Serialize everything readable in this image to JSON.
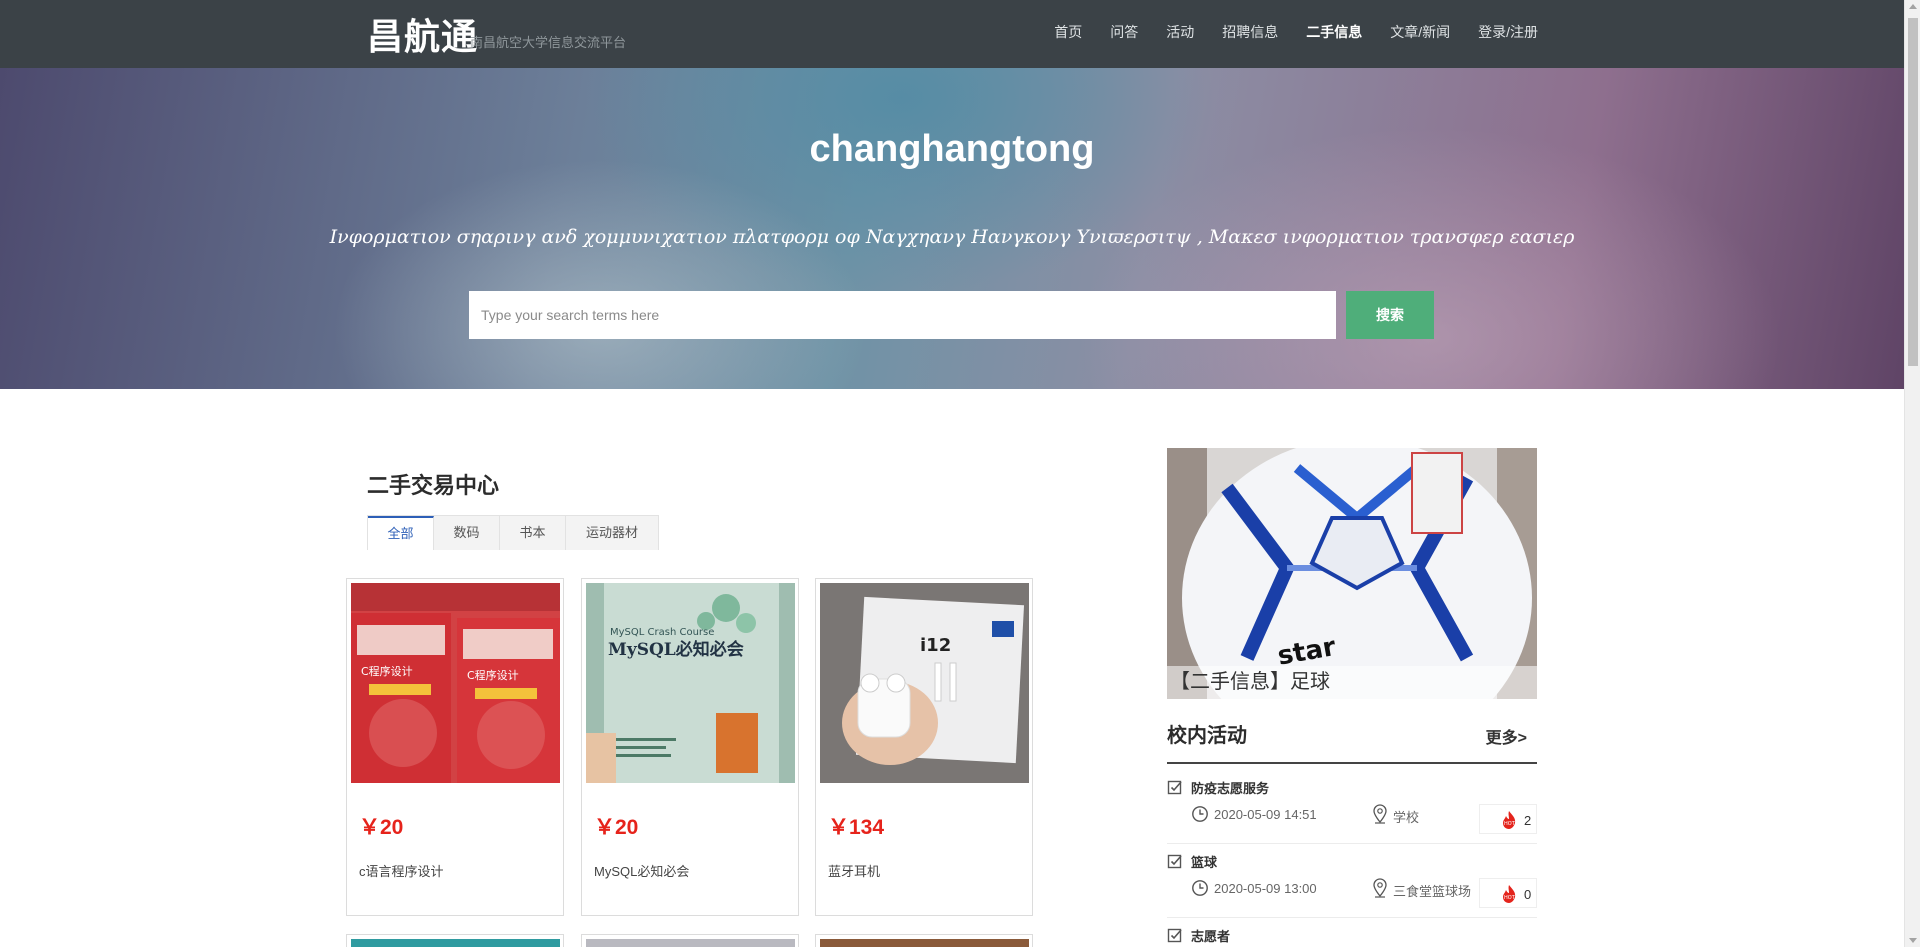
{
  "header": {
    "logo": "昌航通",
    "tagline": "南昌航空大学信息交流平台",
    "nav": [
      {
        "label": "首页"
      },
      {
        "label": "问答"
      },
      {
        "label": "活动"
      },
      {
        "label": "招聘信息"
      },
      {
        "label": "二手信息",
        "active": true
      },
      {
        "label": "文章/新闻"
      },
      {
        "label": "登录/注册"
      }
    ]
  },
  "hero": {
    "title": "changhangtong",
    "subtitle": "Ινφορματιον σηαρινγ ανδ χομμυνιχατιον πλατφορμ οφ Ναγχηανγ Ηανγκονγ Υνιϖερσιτψ , Μακεσ ινφορματιον τρανσφερ εασιερ",
    "search_placeholder": "Type your search terms here",
    "search_button": "搜索"
  },
  "market": {
    "title": "二手交易中心",
    "tabs": [
      {
        "label": "全部",
        "active": true
      },
      {
        "label": "数码"
      },
      {
        "label": "书本"
      },
      {
        "label": "运动器材"
      }
    ],
    "items": [
      {
        "price": "￥20",
        "name": "c语言程序设计"
      },
      {
        "price": "￥20",
        "name": "MySQL必知必会"
      },
      {
        "price": "￥134",
        "name": "蓝牙耳机"
      }
    ]
  },
  "feature": {
    "caption": "【二手信息】足球"
  },
  "activities": {
    "title": "校内活动",
    "more": "更多>",
    "items": [
      {
        "name": "防疫志愿服务",
        "time": "2020-05-09 14:51",
        "place": "学校",
        "hot": "2"
      },
      {
        "name": "篮球",
        "time": "2020-05-09 13:00",
        "place": "三食堂篮球场",
        "hot": "0"
      },
      {
        "name": "志愿者"
      }
    ]
  },
  "colors": {
    "topbar": "#3b4247",
    "accent_green": "#4fae7a",
    "price_red": "#e6231b",
    "tab_active": "#2d5fb7"
  }
}
